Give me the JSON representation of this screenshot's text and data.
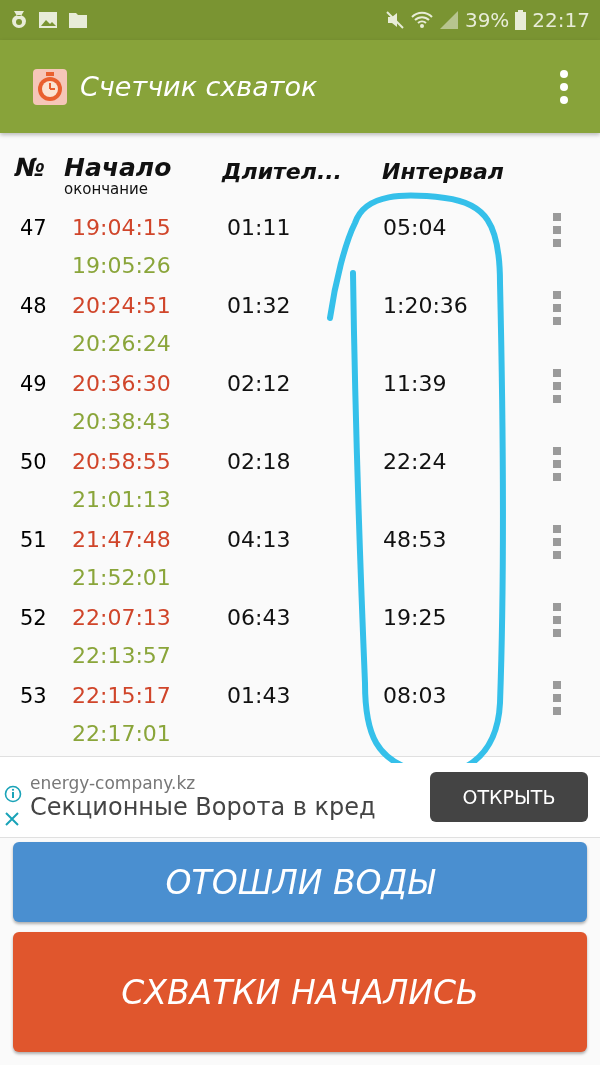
{
  "status_bar": {
    "battery": "39%",
    "time": "22:17"
  },
  "app_bar": {
    "title": "Счетчик схваток"
  },
  "table": {
    "columns": [
      "№",
      "Начало",
      "окончание",
      "Длител...",
      "Интервал"
    ],
    "rows": [
      {
        "number": "47",
        "start": "19:04:15",
        "end": "19:05:26",
        "duration": "01:11",
        "interval": "05:04"
      },
      {
        "number": "48",
        "start": "20:24:51",
        "end": "20:26:24",
        "duration": "01:32",
        "interval": "1:20:36"
      },
      {
        "number": "49",
        "start": "20:36:30",
        "end": "20:38:43",
        "duration": "02:12",
        "interval": "11:39"
      },
      {
        "number": "50",
        "start": "20:58:55",
        "end": "21:01:13",
        "duration": "02:18",
        "interval": "22:24"
      },
      {
        "number": "51",
        "start": "21:47:48",
        "end": "21:52:01",
        "duration": "04:13",
        "interval": "48:53"
      },
      {
        "number": "52",
        "start": "22:07:13",
        "end": "22:13:57",
        "duration": "06:43",
        "interval": "19:25"
      },
      {
        "number": "53",
        "start": "22:15:17",
        "end": "22:17:01",
        "duration": "01:43",
        "interval": "08:03"
      }
    ]
  },
  "ad": {
    "domain": "energy-company.kz",
    "headline": "Секционные Ворота в кред",
    "button": "ОТКРЫТЬ"
  },
  "buttons": [
    {
      "label": "ОТОШЛИ ВОДЫ",
      "kind": "water"
    },
    {
      "label": "СХВАТКИ НАЧАЛИСЬ",
      "kind": "start"
    }
  ]
}
